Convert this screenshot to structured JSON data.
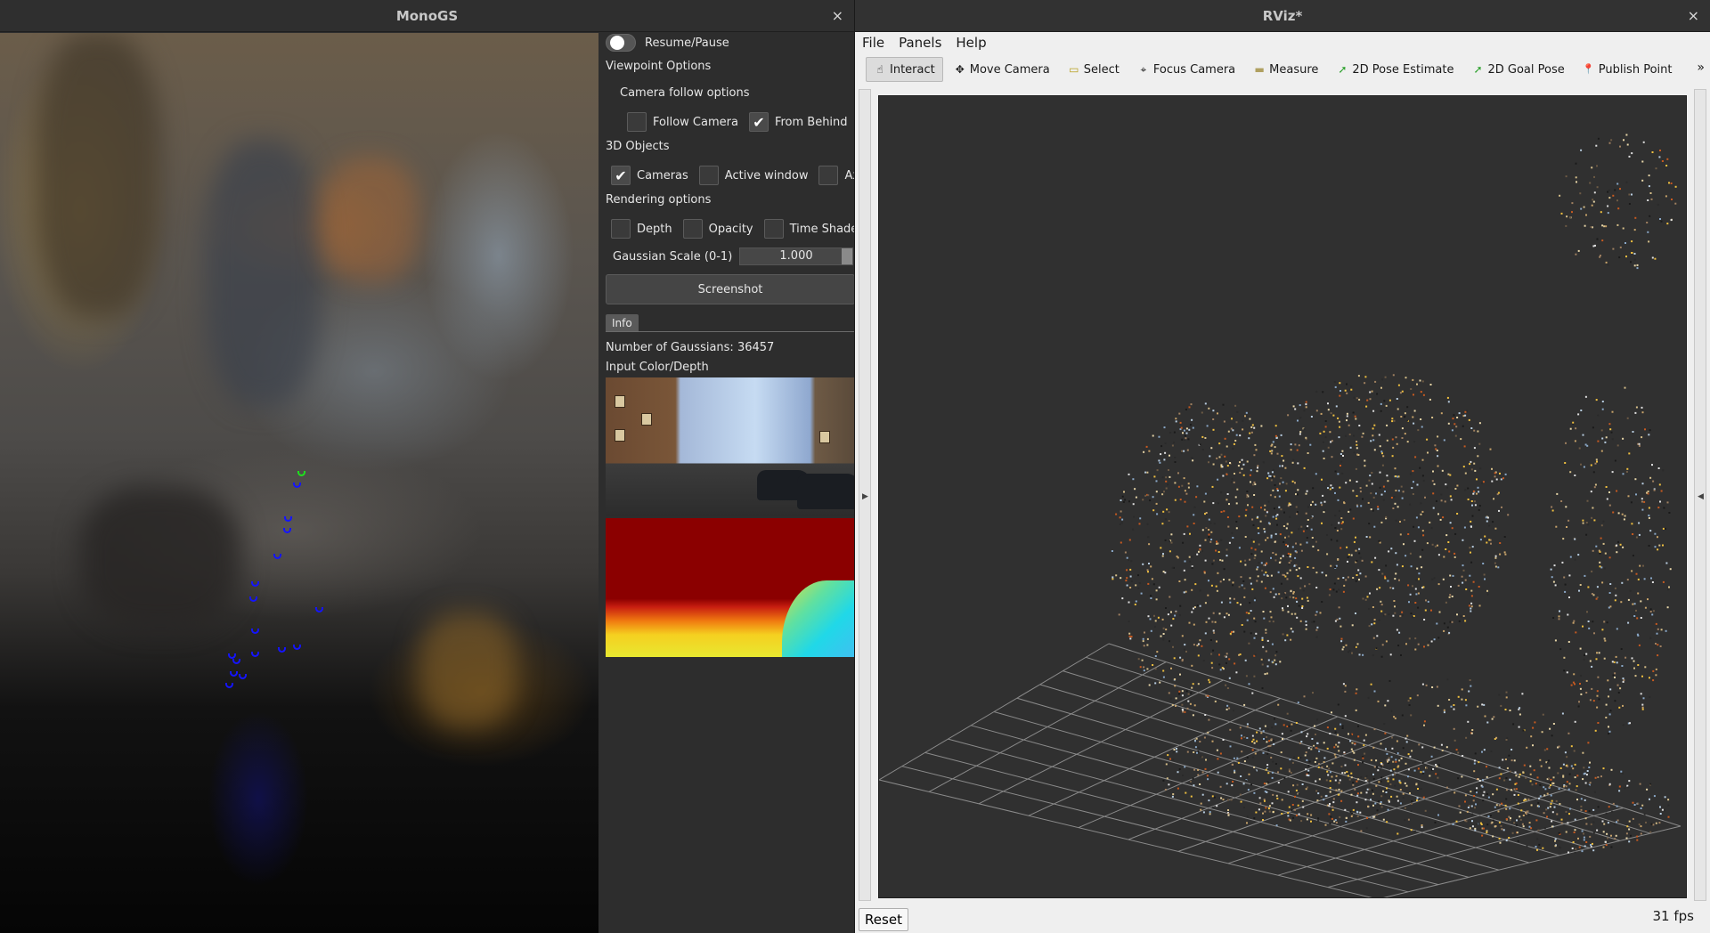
{
  "monogs": {
    "title": "MonoGS",
    "close": "×",
    "controls": {
      "resume_pause": "Resume/Pause",
      "viewpoint_options": "Viewpoint Options",
      "camera_follow_options": "Camera follow options",
      "follow_camera": {
        "label": "Follow Camera",
        "checked": false
      },
      "from_behind": {
        "label": "From Behind",
        "checked": true
      },
      "objects_3d": "3D Objects",
      "cameras": {
        "label": "Cameras",
        "checked": true
      },
      "active_window": {
        "label": "Active window",
        "checked": false
      },
      "axis": {
        "label": "Ax",
        "checked": false
      },
      "rendering_options": "Rendering options",
      "depth": {
        "label": "Depth",
        "checked": false
      },
      "opacity": {
        "label": "Opacity",
        "checked": false
      },
      "time_shader": {
        "label": "Time Shader",
        "checked": false
      },
      "gaussian_scale_label": "Gaussian Scale (0-1)",
      "gaussian_scale_value": "1.000",
      "screenshot": "Screenshot",
      "info_tab": "Info",
      "num_gaussians": "Number of Gaussians: 36457",
      "input_color_depth": "Input Color/Depth"
    },
    "colors": {
      "camera_marker": "#1414ff",
      "current_camera": "#1ee01e"
    }
  },
  "rviz": {
    "title": "RViz*",
    "close": "×",
    "menu": [
      "File",
      "Panels",
      "Help"
    ],
    "tools": [
      {
        "label": "Interact",
        "icon": "interact-icon",
        "glyph": "☝",
        "active": true
      },
      {
        "label": "Move Camera",
        "icon": "move-camera-icon",
        "glyph": "✥",
        "active": false
      },
      {
        "label": "Select",
        "icon": "select-icon",
        "glyph": "▭",
        "active": false
      },
      {
        "label": "Focus Camera",
        "icon": "focus-camera-icon",
        "glyph": "⌖",
        "active": false
      },
      {
        "label": "Measure",
        "icon": "measure-icon",
        "glyph": "▬",
        "active": false
      },
      {
        "label": "2D Pose Estimate",
        "icon": "pose-estimate-icon",
        "glyph": "➚",
        "active": false
      },
      {
        "label": "2D Goal Pose",
        "icon": "goal-pose-icon",
        "glyph": "➚",
        "active": false
      },
      {
        "label": "Publish Point",
        "icon": "publish-point-icon",
        "glyph": "📍",
        "active": false
      }
    ],
    "more": "»",
    "reset": "Reset",
    "fps": "31 fps",
    "colors": {
      "grid": "#8a8a8a",
      "background": "#303030"
    }
  }
}
